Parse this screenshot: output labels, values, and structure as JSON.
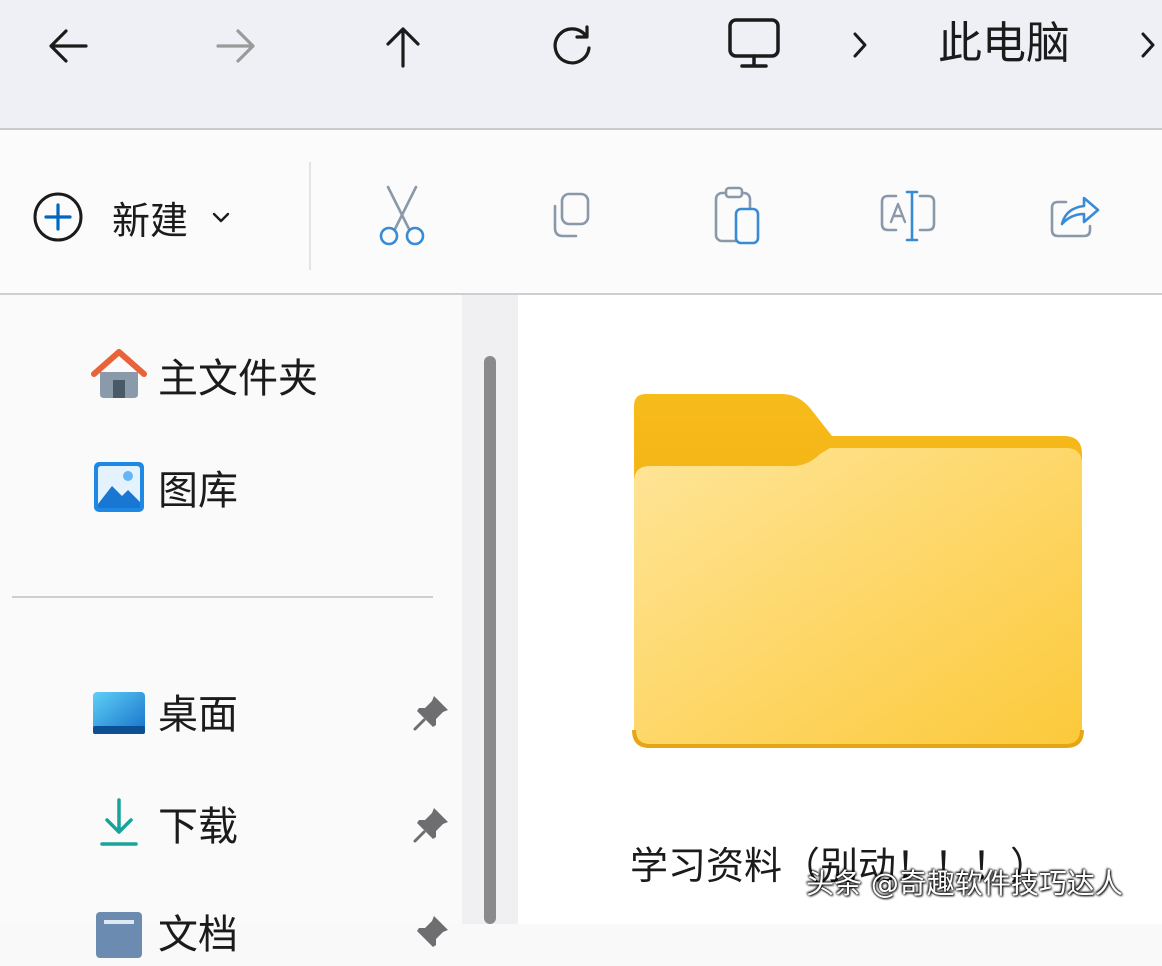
{
  "address_bar": {
    "location_icon": "monitor-icon",
    "crumb": "此电脑",
    "nav": [
      "back-arrow-icon",
      "forward-arrow-icon",
      "up-arrow-icon",
      "refresh-icon"
    ]
  },
  "command_bar": {
    "new_label": "新建",
    "tools": [
      "cut-icon",
      "copy-icon",
      "paste-icon",
      "rename-icon",
      "share-icon"
    ]
  },
  "sidebar": {
    "items": [
      {
        "label": "主文件夹",
        "icon": "home-icon"
      },
      {
        "label": "图库",
        "icon": "gallery-icon"
      },
      {
        "label": "桌面",
        "icon": "desktop-folder-icon",
        "pinned": true
      },
      {
        "label": "下载",
        "icon": "download-icon",
        "pinned": true
      },
      {
        "label": "文档",
        "icon": "documents-icon",
        "pinned": true
      }
    ]
  },
  "content": {
    "folder_name": "学习资料（别动！！！）",
    "folder_icon": "folder-icon"
  },
  "watermark": "头条 @奇趣软件技巧达人",
  "colors": {
    "accent": "#0067c0",
    "folder_back": "#f5b91c",
    "folder_front": "#ffd966",
    "disabled": "#8a99aa"
  }
}
